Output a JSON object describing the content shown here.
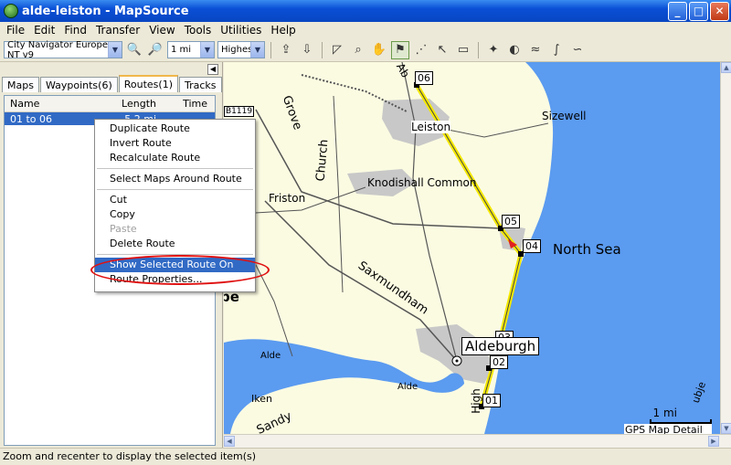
{
  "window": {
    "title": "alde-leiston - MapSource",
    "minimize": "_",
    "maximize": "□",
    "close": "✕"
  },
  "menu": [
    "File",
    "Edit",
    "Find",
    "Transfer",
    "View",
    "Tools",
    "Utilities",
    "Help"
  ],
  "toolbar": {
    "map_product": "City Navigator Europe NT v9",
    "zoom_scale": "1 mi",
    "detail_level": "Highest"
  },
  "tabs": [
    "Maps",
    "Waypoints(6)",
    "Routes(1)",
    "Tracks"
  ],
  "routes_list": {
    "columns": [
      "Name",
      "Length",
      "Time"
    ],
    "rows": [
      {
        "name": "01 to 06",
        "length": "5.2 mi",
        "time": ""
      }
    ]
  },
  "context_menu": {
    "groups": [
      [
        "Duplicate Route",
        "Invert Route",
        "Recalculate Route"
      ],
      [
        "Select Maps Around Route"
      ],
      [
        "Cut",
        "Copy",
        "Paste",
        "Delete Route"
      ],
      [
        "Show Selected Route On Map",
        "Route Properties..."
      ]
    ],
    "disabled": [
      "Paste"
    ],
    "highlighted": "Show Selected Route On Map"
  },
  "map": {
    "labels": {
      "sizewell": "Sizewell",
      "leiston": "Leiston",
      "knodishall": "Knodishall Common",
      "friston": "Friston",
      "north_sea": "North Sea",
      "aldeburgh": "Aldeburgh",
      "alde1": "Alde",
      "alde2": "Alde",
      "iken": "Iken",
      "sandy": "Sandy",
      "grove": "Grove",
      "church": "Church",
      "saxmundham": "Saxmundham",
      "high": "High",
      "road_b1119": "B1119",
      "ab": "Ab",
      "pe": "pe",
      "ubje": "ubje"
    },
    "waypoints": [
      "06",
      "05",
      "04",
      "03",
      "02",
      "01"
    ]
  },
  "scale": {
    "label": "1 mi",
    "detail": "GPS Map Detail"
  },
  "status": "Zoom and recenter to display the selected item(s)"
}
